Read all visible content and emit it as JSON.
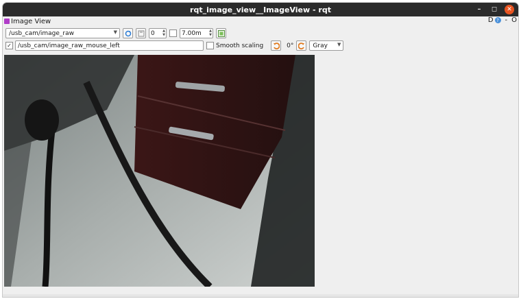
{
  "window": {
    "title": "rqt_image_view__ImageView - rqt",
    "minimize_glyph": "–",
    "maximize_glyph": "◻",
    "close_glyph": "✕"
  },
  "plugin": {
    "title": "Image View",
    "right_label_d": "D",
    "help_glyph": "?",
    "right_label_dash": "-",
    "right_label_o": "O"
  },
  "toolbar": {
    "topic_value": "/usb_cam/image_raw",
    "refresh_icon": "refresh-icon",
    "save_icon": "save-icon",
    "spin_value": "0",
    "max_value": "7.00m",
    "fit_icon": "zoom-fit-icon"
  },
  "row2": {
    "mouse_topic_checked": true,
    "mouse_topic_value": "/usb_cam/image_raw_mouse_left",
    "smooth_label": "Smooth scaling",
    "rotation_label": "0°",
    "colormap_value": "Gray"
  }
}
